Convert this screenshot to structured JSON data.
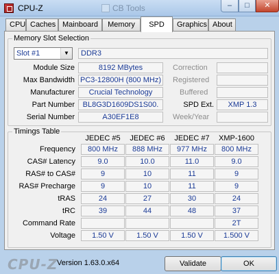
{
  "window": {
    "title": "CPU-Z",
    "background_title": "CB Tools"
  },
  "title_controls": {
    "minimize": "–",
    "maximize": "□",
    "close": "✕"
  },
  "tabs": [
    "CPU",
    "Caches",
    "Mainboard",
    "Memory",
    "SPD",
    "Graphics",
    "About"
  ],
  "active_tab": "SPD",
  "memory_slot": {
    "group_title": "Memory Slot Selection",
    "slot_selected": "Slot #1",
    "memory_type": "DDR3",
    "fields": [
      {
        "label": "Module Size",
        "value": "8192 MBytes"
      },
      {
        "label": "Max Bandwidth",
        "value": "PC3-12800H (800 MHz)"
      },
      {
        "label": "Manufacturer",
        "value": "Crucial Technology"
      },
      {
        "label": "Part Number",
        "value": "BL8G3D1609DS1S00."
      },
      {
        "label": "Serial Number",
        "value": "A30EF1E8"
      }
    ],
    "right_fields": [
      {
        "label": "Correction",
        "value": ""
      },
      {
        "label": "Registered",
        "value": ""
      },
      {
        "label": "Buffered",
        "value": ""
      },
      {
        "label": "SPD Ext.",
        "value": "XMP 1.3"
      },
      {
        "label": "Week/Year",
        "value": ""
      }
    ]
  },
  "timings": {
    "group_title": "Timings Table",
    "columns": [
      "JEDEC #5",
      "JEDEC #6",
      "JEDEC #7",
      "XMP-1600"
    ],
    "rows": [
      {
        "label": "Frequency",
        "values": [
          "800 MHz",
          "888 MHz",
          "977 MHz",
          "800 MHz"
        ]
      },
      {
        "label": "CAS# Latency",
        "values": [
          "9.0",
          "10.0",
          "11.0",
          "9.0"
        ]
      },
      {
        "label": "RAS# to CAS#",
        "values": [
          "9",
          "10",
          "11",
          "9"
        ]
      },
      {
        "label": "RAS# Precharge",
        "values": [
          "9",
          "10",
          "11",
          "9"
        ]
      },
      {
        "label": "tRAS",
        "values": [
          "24",
          "27",
          "30",
          "24"
        ]
      },
      {
        "label": "tRC",
        "values": [
          "39",
          "44",
          "48",
          "37"
        ]
      },
      {
        "label": "Command Rate",
        "values": [
          "",
          "",
          "",
          "2T"
        ]
      },
      {
        "label": "Voltage",
        "values": [
          "1.50 V",
          "1.50 V",
          "1.50 V",
          "1.500 V"
        ]
      }
    ]
  },
  "footer": {
    "logo": "CPU-Z",
    "version": "Version 1.63.0.x64",
    "validate": "Validate",
    "ok": "OK"
  }
}
